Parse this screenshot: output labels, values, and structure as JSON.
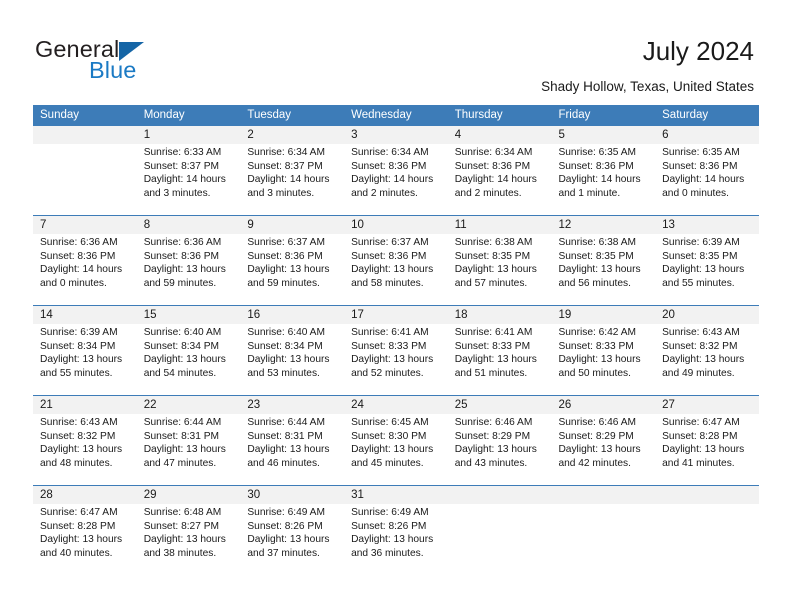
{
  "brand": {
    "name_part1": "General",
    "name_part2": "Blue",
    "triangle_color": "#1565a6",
    "blue_color": "#1b7ac4"
  },
  "header": {
    "title": "July 2024",
    "subtitle": "Shady Hollow, Texas, United States"
  },
  "theme": {
    "header_bg": "#3d7cb8",
    "daynum_bg": "#f2f2f2",
    "cell_bg": "#ffffff",
    "text": "#1a1a1a"
  },
  "weekday_headers": [
    "Sunday",
    "Monday",
    "Tuesday",
    "Wednesday",
    "Thursday",
    "Friday",
    "Saturday"
  ],
  "weeks": [
    {
      "days": [
        {
          "number": "",
          "sunrise": "",
          "sunset": "",
          "daylight_l1": "",
          "daylight_l2": ""
        },
        {
          "number": "1",
          "sunrise": "Sunrise: 6:33 AM",
          "sunset": "Sunset: 8:37 PM",
          "daylight_l1": "Daylight: 14 hours",
          "daylight_l2": "and 3 minutes."
        },
        {
          "number": "2",
          "sunrise": "Sunrise: 6:34 AM",
          "sunset": "Sunset: 8:37 PM",
          "daylight_l1": "Daylight: 14 hours",
          "daylight_l2": "and 3 minutes."
        },
        {
          "number": "3",
          "sunrise": "Sunrise: 6:34 AM",
          "sunset": "Sunset: 8:36 PM",
          "daylight_l1": "Daylight: 14 hours",
          "daylight_l2": "and 2 minutes."
        },
        {
          "number": "4",
          "sunrise": "Sunrise: 6:34 AM",
          "sunset": "Sunset: 8:36 PM",
          "daylight_l1": "Daylight: 14 hours",
          "daylight_l2": "and 2 minutes."
        },
        {
          "number": "5",
          "sunrise": "Sunrise: 6:35 AM",
          "sunset": "Sunset: 8:36 PM",
          "daylight_l1": "Daylight: 14 hours",
          "daylight_l2": "and 1 minute."
        },
        {
          "number": "6",
          "sunrise": "Sunrise: 6:35 AM",
          "sunset": "Sunset: 8:36 PM",
          "daylight_l1": "Daylight: 14 hours",
          "daylight_l2": "and 0 minutes."
        }
      ]
    },
    {
      "days": [
        {
          "number": "7",
          "sunrise": "Sunrise: 6:36 AM",
          "sunset": "Sunset: 8:36 PM",
          "daylight_l1": "Daylight: 14 hours",
          "daylight_l2": "and 0 minutes."
        },
        {
          "number": "8",
          "sunrise": "Sunrise: 6:36 AM",
          "sunset": "Sunset: 8:36 PM",
          "daylight_l1": "Daylight: 13 hours",
          "daylight_l2": "and 59 minutes."
        },
        {
          "number": "9",
          "sunrise": "Sunrise: 6:37 AM",
          "sunset": "Sunset: 8:36 PM",
          "daylight_l1": "Daylight: 13 hours",
          "daylight_l2": "and 59 minutes."
        },
        {
          "number": "10",
          "sunrise": "Sunrise: 6:37 AM",
          "sunset": "Sunset: 8:36 PM",
          "daylight_l1": "Daylight: 13 hours",
          "daylight_l2": "and 58 minutes."
        },
        {
          "number": "11",
          "sunrise": "Sunrise: 6:38 AM",
          "sunset": "Sunset: 8:35 PM",
          "daylight_l1": "Daylight: 13 hours",
          "daylight_l2": "and 57 minutes."
        },
        {
          "number": "12",
          "sunrise": "Sunrise: 6:38 AM",
          "sunset": "Sunset: 8:35 PM",
          "daylight_l1": "Daylight: 13 hours",
          "daylight_l2": "and 56 minutes."
        },
        {
          "number": "13",
          "sunrise": "Sunrise: 6:39 AM",
          "sunset": "Sunset: 8:35 PM",
          "daylight_l1": "Daylight: 13 hours",
          "daylight_l2": "and 55 minutes."
        }
      ]
    },
    {
      "days": [
        {
          "number": "14",
          "sunrise": "Sunrise: 6:39 AM",
          "sunset": "Sunset: 8:34 PM",
          "daylight_l1": "Daylight: 13 hours",
          "daylight_l2": "and 55 minutes."
        },
        {
          "number": "15",
          "sunrise": "Sunrise: 6:40 AM",
          "sunset": "Sunset: 8:34 PM",
          "daylight_l1": "Daylight: 13 hours",
          "daylight_l2": "and 54 minutes."
        },
        {
          "number": "16",
          "sunrise": "Sunrise: 6:40 AM",
          "sunset": "Sunset: 8:34 PM",
          "daylight_l1": "Daylight: 13 hours",
          "daylight_l2": "and 53 minutes."
        },
        {
          "number": "17",
          "sunrise": "Sunrise: 6:41 AM",
          "sunset": "Sunset: 8:33 PM",
          "daylight_l1": "Daylight: 13 hours",
          "daylight_l2": "and 52 minutes."
        },
        {
          "number": "18",
          "sunrise": "Sunrise: 6:41 AM",
          "sunset": "Sunset: 8:33 PM",
          "daylight_l1": "Daylight: 13 hours",
          "daylight_l2": "and 51 minutes."
        },
        {
          "number": "19",
          "sunrise": "Sunrise: 6:42 AM",
          "sunset": "Sunset: 8:33 PM",
          "daylight_l1": "Daylight: 13 hours",
          "daylight_l2": "and 50 minutes."
        },
        {
          "number": "20",
          "sunrise": "Sunrise: 6:43 AM",
          "sunset": "Sunset: 8:32 PM",
          "daylight_l1": "Daylight: 13 hours",
          "daylight_l2": "and 49 minutes."
        }
      ]
    },
    {
      "days": [
        {
          "number": "21",
          "sunrise": "Sunrise: 6:43 AM",
          "sunset": "Sunset: 8:32 PM",
          "daylight_l1": "Daylight: 13 hours",
          "daylight_l2": "and 48 minutes."
        },
        {
          "number": "22",
          "sunrise": "Sunrise: 6:44 AM",
          "sunset": "Sunset: 8:31 PM",
          "daylight_l1": "Daylight: 13 hours",
          "daylight_l2": "and 47 minutes."
        },
        {
          "number": "23",
          "sunrise": "Sunrise: 6:44 AM",
          "sunset": "Sunset: 8:31 PM",
          "daylight_l1": "Daylight: 13 hours",
          "daylight_l2": "and 46 minutes."
        },
        {
          "number": "24",
          "sunrise": "Sunrise: 6:45 AM",
          "sunset": "Sunset: 8:30 PM",
          "daylight_l1": "Daylight: 13 hours",
          "daylight_l2": "and 45 minutes."
        },
        {
          "number": "25",
          "sunrise": "Sunrise: 6:46 AM",
          "sunset": "Sunset: 8:29 PM",
          "daylight_l1": "Daylight: 13 hours",
          "daylight_l2": "and 43 minutes."
        },
        {
          "number": "26",
          "sunrise": "Sunrise: 6:46 AM",
          "sunset": "Sunset: 8:29 PM",
          "daylight_l1": "Daylight: 13 hours",
          "daylight_l2": "and 42 minutes."
        },
        {
          "number": "27",
          "sunrise": "Sunrise: 6:47 AM",
          "sunset": "Sunset: 8:28 PM",
          "daylight_l1": "Daylight: 13 hours",
          "daylight_l2": "and 41 minutes."
        }
      ]
    },
    {
      "days": [
        {
          "number": "28",
          "sunrise": "Sunrise: 6:47 AM",
          "sunset": "Sunset: 8:28 PM",
          "daylight_l1": "Daylight: 13 hours",
          "daylight_l2": "and 40 minutes."
        },
        {
          "number": "29",
          "sunrise": "Sunrise: 6:48 AM",
          "sunset": "Sunset: 8:27 PM",
          "daylight_l1": "Daylight: 13 hours",
          "daylight_l2": "and 38 minutes."
        },
        {
          "number": "30",
          "sunrise": "Sunrise: 6:49 AM",
          "sunset": "Sunset: 8:26 PM",
          "daylight_l1": "Daylight: 13 hours",
          "daylight_l2": "and 37 minutes."
        },
        {
          "number": "31",
          "sunrise": "Sunrise: 6:49 AM",
          "sunset": "Sunset: 8:26 PM",
          "daylight_l1": "Daylight: 13 hours",
          "daylight_l2": "and 36 minutes."
        },
        {
          "number": "",
          "sunrise": "",
          "sunset": "",
          "daylight_l1": "",
          "daylight_l2": ""
        },
        {
          "number": "",
          "sunrise": "",
          "sunset": "",
          "daylight_l1": "",
          "daylight_l2": ""
        },
        {
          "number": "",
          "sunrise": "",
          "sunset": "",
          "daylight_l1": "",
          "daylight_l2": ""
        }
      ]
    }
  ]
}
